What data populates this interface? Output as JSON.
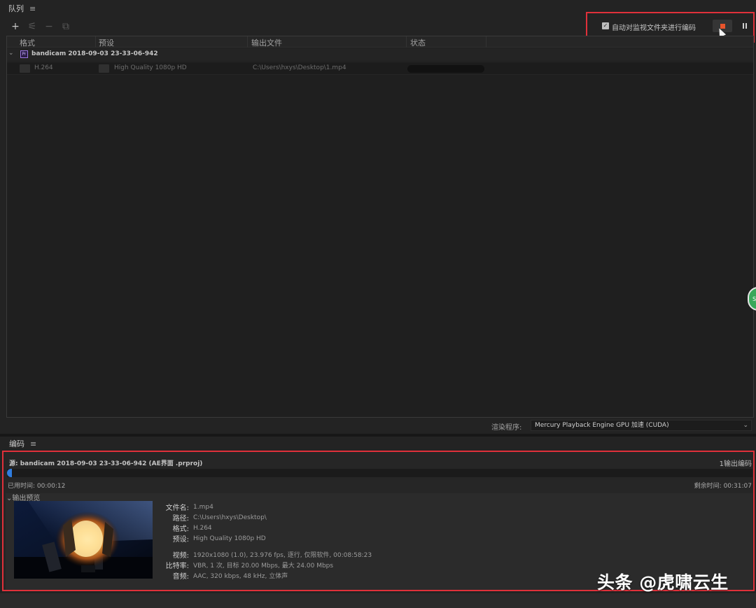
{
  "queue": {
    "title": "队列",
    "menu_icon": "≡",
    "toolbar": {
      "add": "+",
      "settings": "⚟",
      "remove": "−",
      "duplicate": "⧉"
    },
    "watch_folder": {
      "checked": true,
      "check_mark": "✓",
      "label": "自动对监视文件夹进行编码"
    },
    "columns": [
      "格式",
      "预设",
      "输出文件",
      "状态"
    ],
    "source": {
      "expand_icon": "⌄",
      "badge": "Pr",
      "name": "bandicam 2018-09-03 23-33-06-942"
    },
    "output": {
      "format": "H.264",
      "preset": "High Quality 1080p HD",
      "file": "C:\\Users\\hxys\\Desktop\\1.mp4"
    },
    "renderer": {
      "label": "渲染程序:",
      "value": "Mercury Playback Engine GPU 加速 (CUDA)",
      "chevron": "⌄"
    },
    "side_bubble": "SJ"
  },
  "encoding": {
    "title": "编码",
    "menu_icon": "≡",
    "source": "源: bandicam  2018-09-03  23-33-06-942  (AE界面 .prproj)",
    "output_count": "1输出编码",
    "progress_fraction": 0.007,
    "elapsed": "已用时间: 00:00:12",
    "remaining": "剩余时间: 00:31:07",
    "preview_toggle": "⌄输出预览",
    "info": [
      {
        "label": "文件名:",
        "value": "1.mp4"
      },
      {
        "label": "路径:",
        "value": "C:\\Users\\hxys\\Desktop\\"
      },
      {
        "label": "格式:",
        "value": "H.264"
      },
      {
        "label": "预设:",
        "value": "High Quality 1080p HD"
      },
      {
        "label": "视频:",
        "value": "1920x1080 (1.0), 23.976 fps, 逐行, 仅限软件, 00:08:58:23"
      },
      {
        "label": "比特率:",
        "value": "VBR, 1 次, 目标 20.00 Mbps, 最大 24.00 Mbps"
      },
      {
        "label": "音频:",
        "value": "AAC, 320 kbps, 48 kHz, 立体声"
      }
    ]
  },
  "watermark": "头条 @虎啸云生",
  "colors": {
    "accent_red_box": "#e0303a",
    "stop_orange": "#e8542b",
    "progress_blue": "#2f7de0",
    "premiere_purple": "#9a75e0"
  }
}
